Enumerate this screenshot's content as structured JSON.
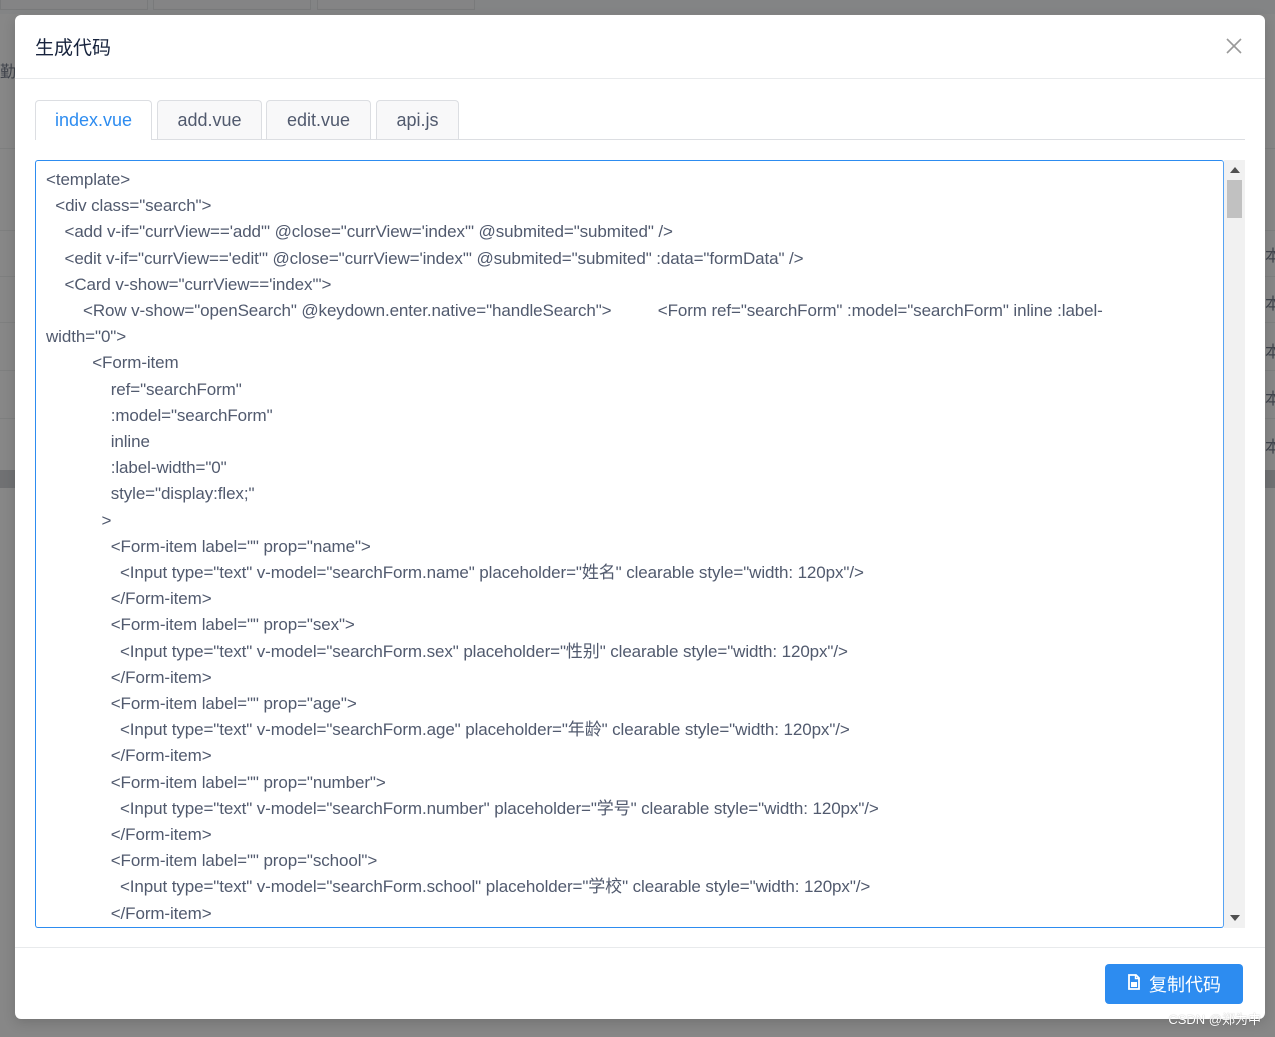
{
  "background": {
    "left_text": "勤续",
    "right_char": "本"
  },
  "dialog": {
    "title": "生成代码",
    "close_icon": "close-icon"
  },
  "tabs": [
    {
      "label": "index.vue",
      "active": true
    },
    {
      "label": "add.vue",
      "active": false
    },
    {
      "label": "edit.vue",
      "active": false
    },
    {
      "label": "api.js",
      "active": false
    }
  ],
  "code": {
    "lines": [
      "<template>",
      "  <div class=\"search\">",
      "    <add v-if=\"currView=='add'\" @close=\"currView='index'\" @submited=\"submited\" />",
      "    <edit v-if=\"currView=='edit'\" @close=\"currView='index'\" @submited=\"submited\" :data=\"formData\" />",
      "    <Card v-show=\"currView=='index'\">",
      "        <Row v-show=\"openSearch\" @keydown.enter.native=\"handleSearch\">          <Form ref=\"searchForm\" :model=\"searchForm\" inline :label-",
      "width=\"0\">",
      "          <Form-item",
      "              ref=\"searchForm\"",
      "              :model=\"searchForm\"",
      "              inline",
      "              :label-width=\"0\"",
      "              style=\"display:flex;\"",
      "            >",
      "              <Form-item label=\"\" prop=\"name\">",
      "                <Input type=\"text\" v-model=\"searchForm.name\" placeholder=\"姓名\" clearable style=\"width: 120px\"/>",
      "              </Form-item>",
      "              <Form-item label=\"\" prop=\"sex\">",
      "                <Input type=\"text\" v-model=\"searchForm.sex\" placeholder=\"性别\" clearable style=\"width: 120px\"/>",
      "              </Form-item>",
      "              <Form-item label=\"\" prop=\"age\">",
      "                <Input type=\"text\" v-model=\"searchForm.age\" placeholder=\"年龄\" clearable style=\"width: 120px\"/>",
      "              </Form-item>",
      "              <Form-item label=\"\" prop=\"number\">",
      "                <Input type=\"text\" v-model=\"searchForm.number\" placeholder=\"学号\" clearable style=\"width: 120px\"/>",
      "              </Form-item>",
      "              <Form-item label=\"\" prop=\"school\">",
      "                <Input type=\"text\" v-model=\"searchForm.school\" placeholder=\"学校\" clearable style=\"width: 120px\"/>",
      "              </Form-item>"
    ]
  },
  "footer": {
    "copy_label": "复制代码",
    "copy_icon": "document-icon"
  },
  "watermark": "CSDN @郑为中",
  "colors": {
    "primary": "#2d8cf0",
    "text": "#515a6e",
    "title": "#17233d"
  }
}
